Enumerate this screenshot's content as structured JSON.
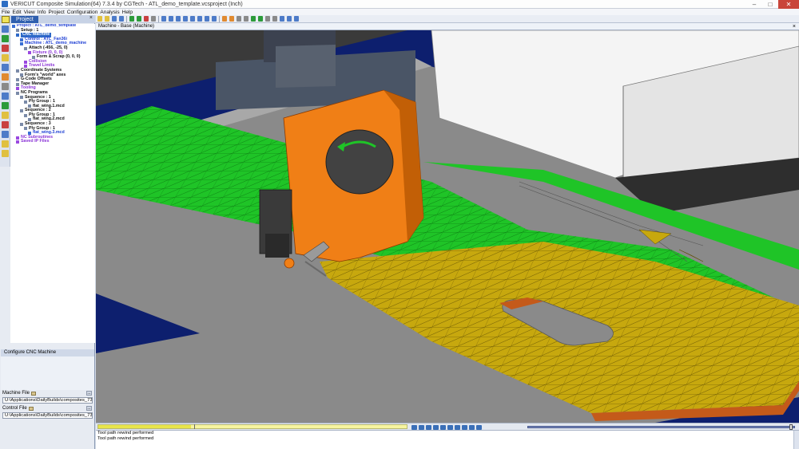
{
  "window": {
    "title": "VERICUT Composite Simulation(64) 7.3.4 by CGTech - ATL_demo_template.vcsproject (Inch)",
    "controls": {
      "minimize": "–",
      "maximize": "□",
      "close": "✕"
    }
  },
  "menu": [
    "File",
    "Edit",
    "View",
    "Info",
    "Project",
    "Configuration",
    "Analysis",
    "Help"
  ],
  "left_panel": {
    "tab_label": "Project",
    "tab_close": "×",
    "tree": [
      {
        "indent": 0,
        "label": "Project : ATL_demo_template",
        "color": "blue"
      },
      {
        "indent": 1,
        "label": "Setup : 1",
        "color": "black"
      },
      {
        "indent": 1,
        "label": "CNC Machine",
        "color": "selected"
      },
      {
        "indent": 2,
        "label": "Control : ATL_Fan36i",
        "color": "blue"
      },
      {
        "indent": 2,
        "label": "Machine : ATL_demo_machine",
        "color": "blue"
      },
      {
        "indent": 3,
        "label": "Attach (-456, -25, 0)",
        "color": "black"
      },
      {
        "indent": 4,
        "label": "Fixture (0, 0, 0)",
        "color": "purple"
      },
      {
        "indent": 5,
        "label": "Form & Scrap (0, 0, 0)",
        "color": "black"
      },
      {
        "indent": 3,
        "label": "Collision",
        "color": "purple"
      },
      {
        "indent": 3,
        "label": "Travel Limits",
        "color": "purple"
      },
      {
        "indent": 1,
        "label": "Coordinate Systems",
        "color": "black"
      },
      {
        "indent": 2,
        "label": "Form's \"world\" axes",
        "color": "black"
      },
      {
        "indent": 1,
        "label": "G-Code Offsets",
        "color": "black"
      },
      {
        "indent": 1,
        "label": "Tape Manager",
        "color": "black"
      },
      {
        "indent": 1,
        "label": "Tooling",
        "color": "purple"
      },
      {
        "indent": 1,
        "label": "NC Programs",
        "color": "black"
      },
      {
        "indent": 2,
        "label": "Sequence : 1",
        "color": "black"
      },
      {
        "indent": 3,
        "label": "Ply Group : 1",
        "color": "black"
      },
      {
        "indent": 4,
        "label": "flat_wing.1.mcd",
        "color": "black"
      },
      {
        "indent": 2,
        "label": "Sequence : 2",
        "color": "black"
      },
      {
        "indent": 3,
        "label": "Ply Group : 1",
        "color": "black"
      },
      {
        "indent": 4,
        "label": "flat_wing.2.mcd",
        "color": "black"
      },
      {
        "indent": 2,
        "label": "Sequence : 3",
        "color": "black"
      },
      {
        "indent": 3,
        "label": "Ply Group : 1",
        "color": "black"
      },
      {
        "indent": 4,
        "label": "flat_wing.3.mcd",
        "color": "blue"
      },
      {
        "indent": 1,
        "label": "NC Subroutines",
        "color": "purple"
      },
      {
        "indent": 1,
        "label": "Saved IP Files",
        "color": "purple"
      }
    ],
    "config_title": "Configure CNC Machine",
    "machine_file_label": "Machine File",
    "machine_file_value": "U:\\Applications\\DailyBuilds\\composites_73\\sa...",
    "control_file_label": "Control File",
    "control_file_value": "U:\\Applications\\DailyBuilds\\composites_73\\sa...",
    "field_btn": "..."
  },
  "viewport": {
    "title": "Machine - Base (Machine)",
    "close": "×"
  },
  "simulation": {
    "progress_fraction": 0.3,
    "speed_fraction": 0.995
  },
  "log": {
    "lines": [
      "Tool path rewind performed",
      "Tool path rewind performed"
    ]
  },
  "colors": {
    "head_orange": "#f07f16",
    "ply_green": "#1fc427",
    "ply_yellow": "#c7a80e",
    "table_gray": "#8a8a8a",
    "bed_navy": "#0d1f6e",
    "selection_blue": "#2f6ac8"
  }
}
